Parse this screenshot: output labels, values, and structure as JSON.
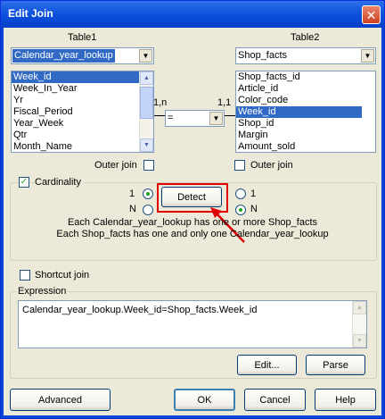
{
  "window": {
    "title": "Edit Join",
    "close_glyph": "✕"
  },
  "table1": {
    "label": "Table1",
    "selected": "Calendar_year_lookup",
    "columns": [
      "Week_id",
      "Week_In_Year",
      "Yr",
      "Fiscal_Period",
      "Year_Week",
      "Qtr",
      "Month_Name"
    ],
    "selected_column": "Week_id"
  },
  "table2": {
    "label": "Table2",
    "selected": "Shop_facts",
    "columns": [
      "Shop_facts_id",
      "Article_id",
      "Color_code",
      "Week_id",
      "Shop_id",
      "Margin",
      "Amount_sold"
    ],
    "selected_column": "Week_id"
  },
  "operator": {
    "value": "="
  },
  "cardinality_left": "1,n",
  "cardinality_right": "1,1",
  "outer_join_left": "Outer join",
  "outer_join_right": "Outer join",
  "cardinality": {
    "label": "Cardinality",
    "checked": true,
    "left_one": "1",
    "left_many": "N",
    "right_one": "1",
    "right_many": "N",
    "detect_label": "Detect",
    "desc1": "Each Calendar_year_lookup has one or more Shop_facts",
    "desc2": "Each Shop_facts has one and only one Calendar_year_lookup"
  },
  "shortcut_join": "Shortcut join",
  "expression": {
    "label": "Expression",
    "value": "Calendar_year_lookup.Week_id=Shop_facts.Week_id",
    "edit_label": "Edit...",
    "parse_label": "Parse"
  },
  "buttons": {
    "advanced": "Advanced",
    "ok": "OK",
    "cancel": "Cancel",
    "help": "Help"
  },
  "colors": {
    "highlight": "#e00000",
    "selection": "#316ac5",
    "title_bar": "#0a4fdc"
  }
}
